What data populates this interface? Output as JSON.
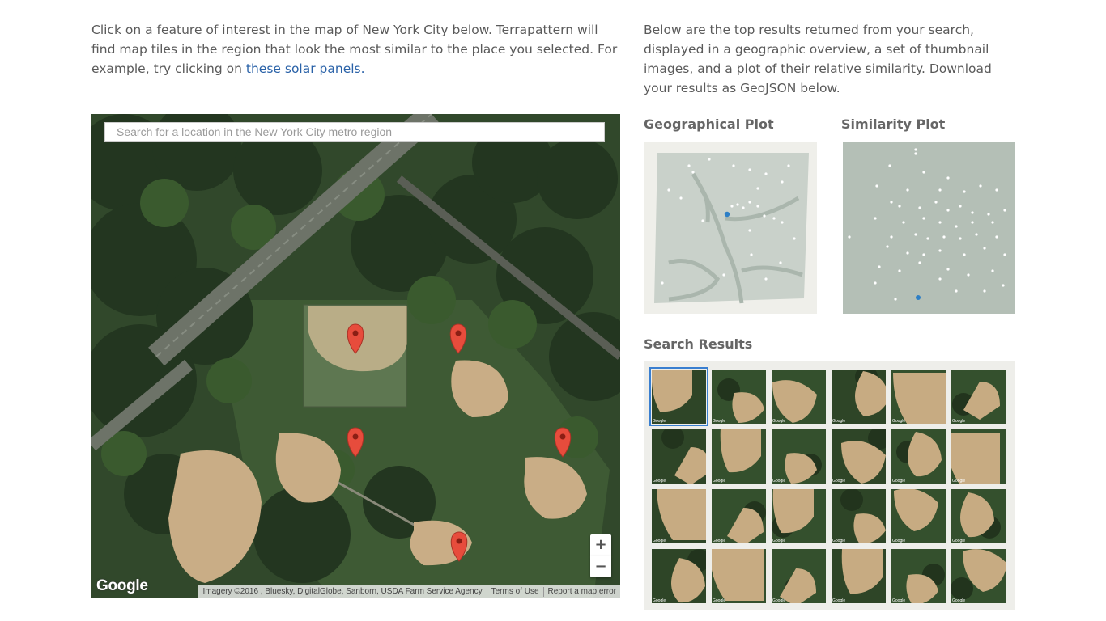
{
  "intro_left": {
    "text": "Click on a feature of interest in the map of New York City below. Terrapattern will find map tiles in the region that look the most similar to the place you selected. For example, try clicking on ",
    "link": "these solar panels."
  },
  "intro_right": {
    "text": "Below are the top results returned from your search, displayed in a geographic overview, a set of thumbnail images, and a plot of their relative similarity. Download your results as GeoJSON below."
  },
  "map": {
    "search_placeholder": "Search for a location in the New York City metro region",
    "zoom_in": "+",
    "zoom_out": "−",
    "logo": "Google",
    "attribution": "Imagery ©2016 , Bluesky, DigitalGlobe, Sanborn, USDA Farm Service Agency",
    "terms": "Terms of Use",
    "report": "Report a map error",
    "marker_icon": "map-pin-icon",
    "colors": {
      "marker": "#e74c3c",
      "infield": "#c9ad86",
      "trees": "#2c3d22"
    }
  },
  "geo_plot": {
    "title": "Geographical Plot",
    "colors": {
      "land": "#c9d1ca",
      "water": "#aab6ad",
      "dot": "#ffffff",
      "query_dot": "#2d7fc6"
    }
  },
  "sim_plot": {
    "title": "Similarity Plot",
    "colors": {
      "background": "#b4bfb6",
      "dot": "#ffffff",
      "query_dot": "#2d7fc6"
    }
  },
  "results": {
    "title": "Search Results",
    "thumb_caption": "Google",
    "count": 24,
    "rows": 4,
    "columns": 6
  }
}
